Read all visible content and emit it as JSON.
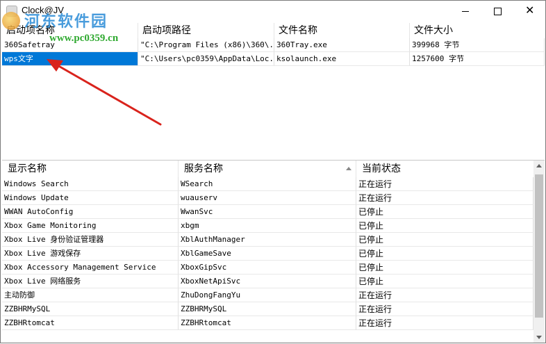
{
  "window": {
    "title": "Clock@JV"
  },
  "watermark": {
    "name": "河东软件园",
    "url": "www.pc0359.cn"
  },
  "window_controls": {
    "minimize": "—",
    "maximize": "□",
    "close": "✕"
  },
  "startup_table": {
    "headers": [
      "启动项名称",
      "启动项路径",
      "文件名称",
      "文件大小"
    ],
    "rows": [
      {
        "name": "360Safetray",
        "path": "\"C:\\Program Files (x86)\\360\\...",
        "file": "360Tray.exe",
        "size": "399968 字节"
      },
      {
        "name": "wps文字",
        "path": "\"C:\\Users\\pc0359\\AppData\\Loc...",
        "file": "ksolaunch.exe",
        "size": "1257600 字节"
      }
    ],
    "selected_row": 1
  },
  "services_table": {
    "headers": [
      "显示名称",
      "服务名称",
      "当前状态"
    ],
    "rows": [
      {
        "display": "Windows Search",
        "service": "WSearch",
        "status": "正在运行"
      },
      {
        "display": "Windows Update",
        "service": "wuauserv",
        "status": "正在运行"
      },
      {
        "display": "WWAN AutoConfig",
        "service": "WwanSvc",
        "status": "已停止"
      },
      {
        "display": "Xbox Game Monitoring",
        "service": "xbgm",
        "status": "已停止"
      },
      {
        "display": "Xbox Live 身份验证管理器",
        "service": "XblAuthManager",
        "status": "已停止"
      },
      {
        "display": "Xbox Live 游戏保存",
        "service": "XblGameSave",
        "status": "已停止"
      },
      {
        "display": "Xbox Accessory Management Service",
        "service": "XboxGipSvc",
        "status": "已停止"
      },
      {
        "display": "Xbox Live 网络服务",
        "service": "XboxNetApiSvc",
        "status": "已停止"
      },
      {
        "display": "主动防御",
        "service": "ZhuDongFangYu",
        "status": "正在运行"
      },
      {
        "display": "ZZBHRMySQL",
        "service": "ZZBHRMySQL",
        "status": "正在运行"
      },
      {
        "display": "ZZBHRtomcat",
        "service": "ZZBHRtomcat",
        "status": "正在运行"
      }
    ]
  },
  "colors": {
    "selection": "#0078d7",
    "annotation_arrow": "#d9231c"
  }
}
